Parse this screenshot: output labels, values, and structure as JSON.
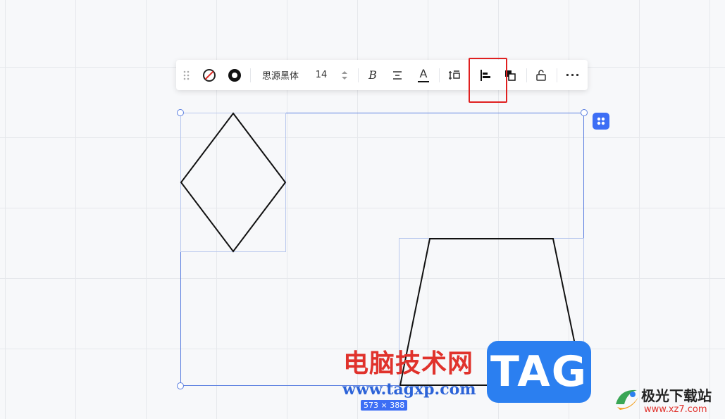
{
  "toolbar": {
    "font_name": "思源黑体",
    "font_size": "14",
    "items": [
      {
        "name": "drag-handle-icon"
      },
      {
        "name": "fill-none-icon"
      },
      {
        "name": "border-style-icon"
      },
      {
        "name": "bold-icon"
      },
      {
        "name": "text-align-icon"
      },
      {
        "name": "font-color-icon"
      },
      {
        "name": "spacing-icon"
      },
      {
        "name": "align-left-icon"
      },
      {
        "name": "layer-order-icon"
      },
      {
        "name": "unlock-icon"
      },
      {
        "name": "more-icon"
      }
    ],
    "bold_label": "B",
    "font_color_label": "A",
    "more_label": "···"
  },
  "selection": {
    "dimensions": "573 × 388",
    "accent_color": "#3d6ef5"
  },
  "shapes": [
    {
      "type": "diamond"
    },
    {
      "type": "trapezoid"
    }
  ],
  "watermark": {
    "title": "电脑技术网",
    "url": "www.tagxp.com",
    "tag": "TAG",
    "site_name": "极光下载站",
    "site_url": "www.xz7.com"
  },
  "highlight_color": "#e02020"
}
